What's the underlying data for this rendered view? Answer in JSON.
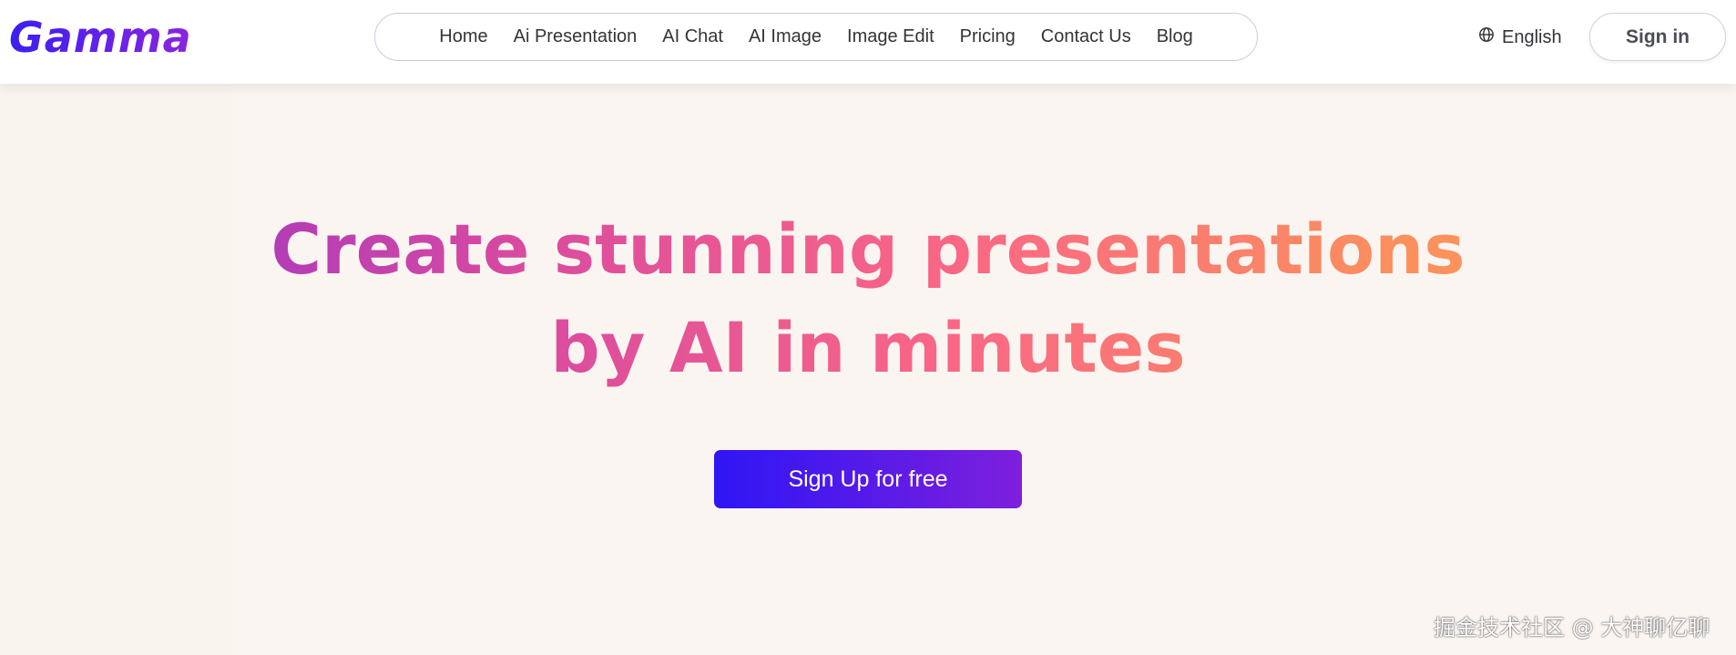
{
  "header": {
    "logo_text": "Gamma",
    "nav_items": [
      {
        "label": "Home"
      },
      {
        "label": "Ai Presentation"
      },
      {
        "label": "AI Chat"
      },
      {
        "label": "AI Image"
      },
      {
        "label": "Image Edit"
      },
      {
        "label": "Pricing"
      },
      {
        "label": "Contact Us"
      },
      {
        "label": "Blog"
      }
    ],
    "language": {
      "label": "English",
      "icon": "globe-icon"
    },
    "signin_label": "Sign in"
  },
  "hero": {
    "headline_line1": "Create stunning presentations",
    "headline_line2": "by AI in minutes",
    "cta_label": "Sign Up for free"
  },
  "watermark": "掘金技术社区 @ 大神聊亿聊",
  "colors": {
    "brand": "#5b1fe0",
    "cta_start": "#2e16f5",
    "cta_end": "#7e1fdc",
    "gradient_start": "#8a2dd0",
    "gradient_mid": "#fa6785",
    "gradient_end": "#fba252",
    "background": "#fbf5f1"
  }
}
